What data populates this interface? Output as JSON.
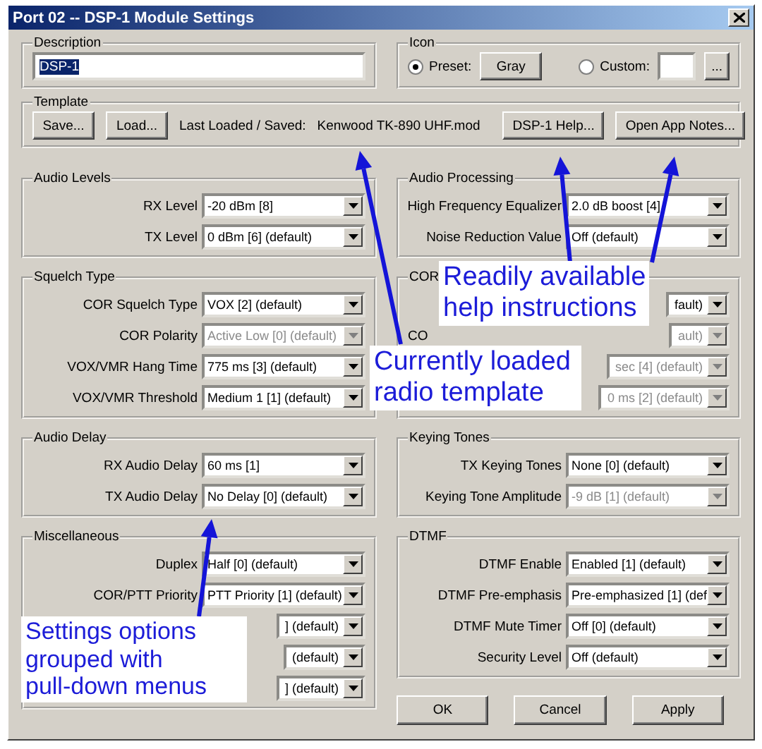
{
  "window": {
    "title": "Port 02 -- DSP-1 Module Settings"
  },
  "description": {
    "title": "Description",
    "value": "DSP-1",
    "text_selected": true
  },
  "icon": {
    "title": "Icon",
    "options": [
      {
        "label": "Preset:",
        "selected": true
      },
      {
        "label": "Custom:",
        "selected": false
      }
    ],
    "preset_button": "Gray",
    "browse_button": "..."
  },
  "template": {
    "title": "Template",
    "buttons": [
      "Save...",
      "Load..."
    ],
    "last_loaded_label": "Last Loaded / Saved:",
    "last_loaded_value": "Kenwood TK-890 UHF.mod",
    "help_buttons": [
      "DSP-1 Help...",
      "Open App Notes..."
    ]
  },
  "left_column": [
    {
      "title": "Audio Levels",
      "rows": [
        {
          "label": "RX Level",
          "value": "-20 dBm [8]",
          "disabled": false,
          "covered": false
        },
        {
          "label": "TX Level",
          "value": "0 dBm [6] (default)",
          "disabled": false,
          "covered": false
        }
      ]
    },
    {
      "title": "Squelch Type",
      "rows": [
        {
          "label": "COR Squelch Type",
          "value": "VOX [2] (default)",
          "disabled": false,
          "covered": false
        },
        {
          "label": "COR Polarity",
          "value": "Active Low [0] (default)",
          "disabled": true,
          "covered": false
        },
        {
          "label": "VOX/VMR Hang Time",
          "value": "775 ms [3] (default)",
          "disabled": false,
          "covered": false
        },
        {
          "label": "VOX/VMR Threshold",
          "value": "Medium 1 [1] (default)",
          "disabled": false,
          "covered": false
        }
      ]
    },
    {
      "title": "Audio Delay",
      "rows": [
        {
          "label": "RX Audio Delay",
          "value": "60 ms [1]",
          "disabled": false,
          "covered": false
        },
        {
          "label": "TX Audio Delay",
          "value": "No Delay [0] (default)",
          "disabled": false,
          "covered": false
        }
      ]
    },
    {
      "title": "Miscellaneous",
      "rows": [
        {
          "label": "Duplex",
          "value": "Half [0] (default)",
          "disabled": false,
          "covered": false
        },
        {
          "label": "COR/PTT Priority",
          "value": "PTT Priority [1] (default)",
          "disabled": false,
          "covered": false
        },
        {
          "value": "] (default)",
          "disabled": false,
          "covered": true
        },
        {
          "value": "(default)",
          "disabled": false,
          "covered": true
        },
        {
          "value": "] (default)",
          "disabled": false,
          "covered": true
        }
      ]
    }
  ],
  "right_column": [
    {
      "title": "Audio Processing",
      "rows": [
        {
          "label": "High Frequency Equalizer",
          "value": "2.0 dB boost [4]",
          "disabled": false,
          "covered": false
        },
        {
          "label": "Noise Reduction Value",
          "value": "Off (default)",
          "disabled": false,
          "covered": false
        }
      ]
    },
    {
      "title": "COR",
      "rows": [
        {
          "value": "fault)",
          "disabled": false,
          "covered": true
        },
        {
          "label": "CO",
          "value": "ault)",
          "disabled": true,
          "covered": true
        },
        {
          "value": "sec [4] (default)",
          "disabled": true,
          "covered": true
        },
        {
          "value": "0 ms [2] (default)",
          "disabled": true,
          "covered": true
        }
      ]
    },
    {
      "title": "Keying Tones",
      "rows": [
        {
          "label": "TX Keying Tones",
          "value": "None [0] (default)",
          "disabled": false,
          "covered": false
        },
        {
          "label": "Keying Tone Amplitude",
          "value": "-9 dB [1] (default)",
          "disabled": true,
          "covered": false
        }
      ]
    },
    {
      "title": "DTMF",
      "rows": [
        {
          "label": "DTMF Enable",
          "value": "Enabled [1] (default)",
          "disabled": false,
          "covered": false
        },
        {
          "label": "DTMF Pre-emphasis",
          "value": "Pre-emphasized [1] (def",
          "disabled": false,
          "covered": false
        },
        {
          "label": "DTMF Mute Timer",
          "value": "Off [0] (default)",
          "disabled": false,
          "covered": false
        },
        {
          "label": "Security Level",
          "value": "Off (default)",
          "disabled": false,
          "covered": false
        }
      ]
    }
  ],
  "buttons": [
    "OK",
    "Cancel",
    "Apply"
  ],
  "callouts": [
    {
      "lines": [
        "Readily available",
        "help instructions"
      ]
    },
    {
      "lines": [
        "Currently loaded",
        "radio template"
      ]
    },
    {
      "lines": [
        "Settings options",
        "grouped with",
        "pull-down menus"
      ]
    }
  ]
}
